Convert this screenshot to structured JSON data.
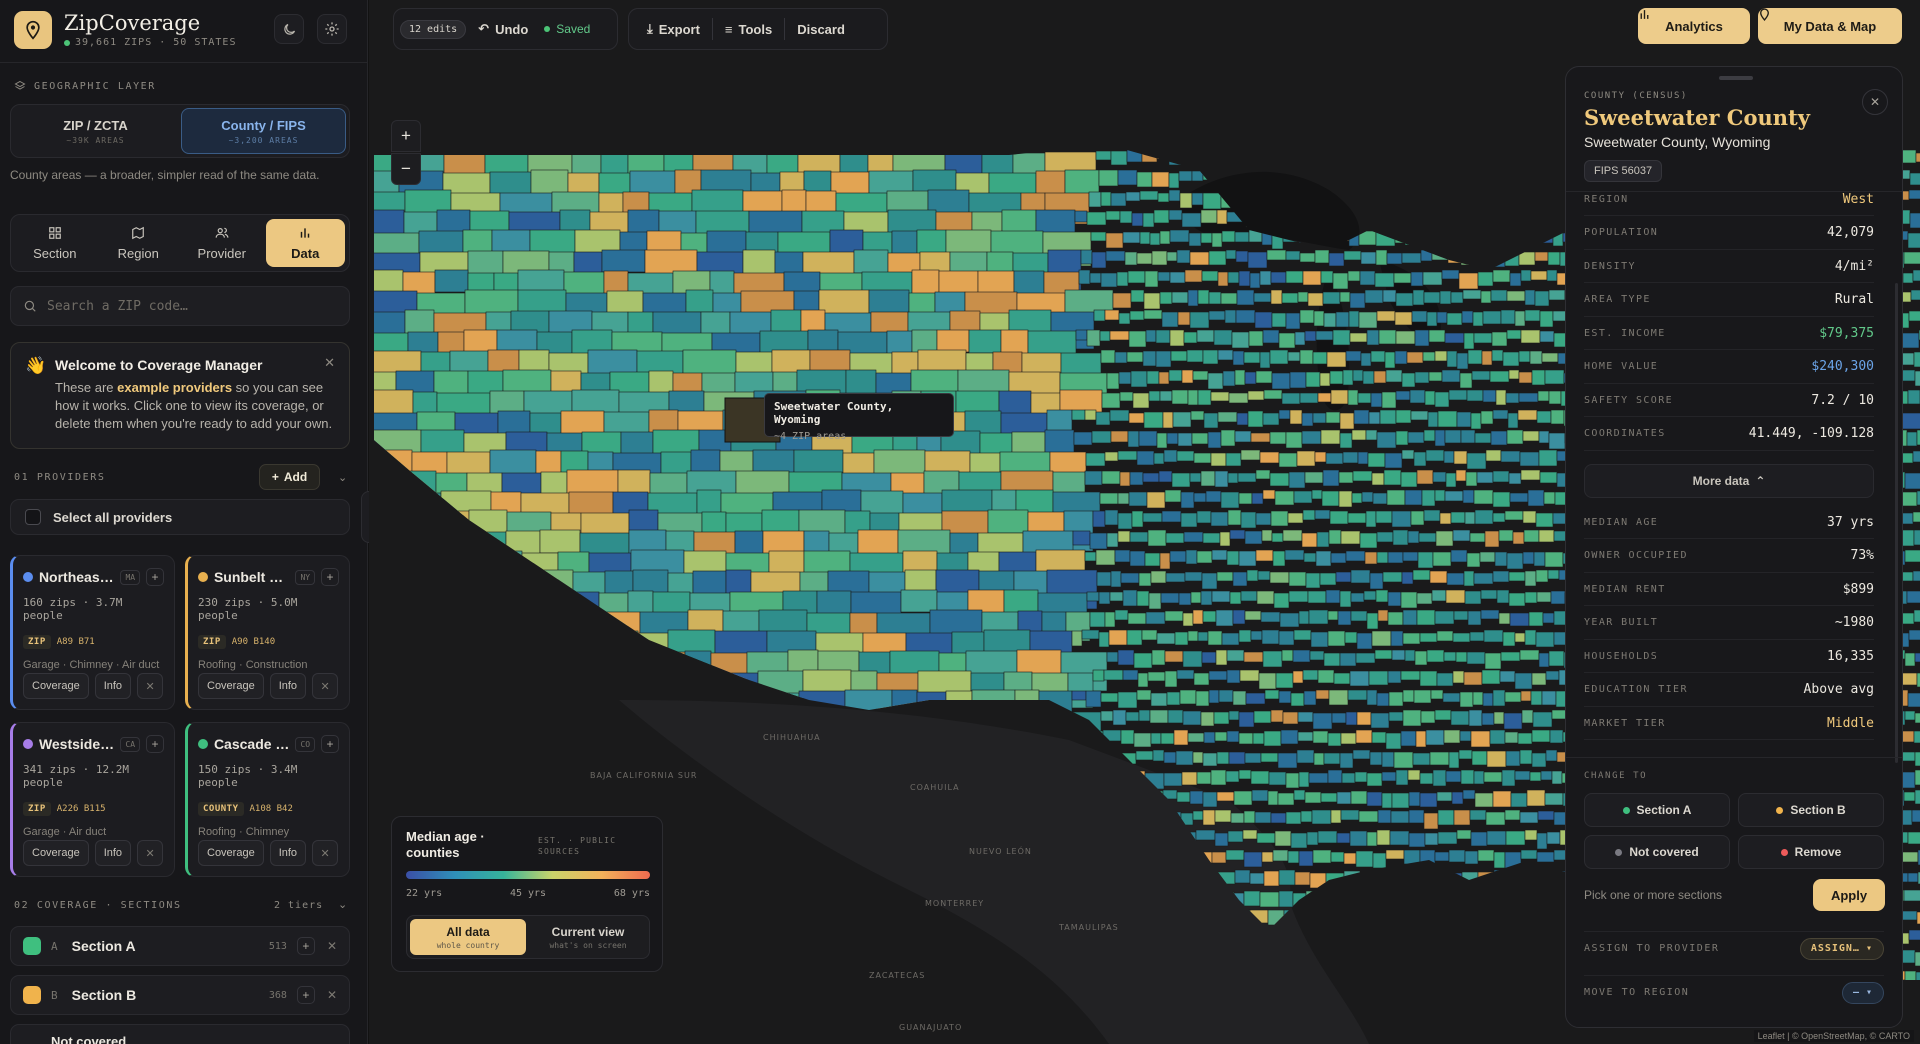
{
  "app": {
    "title": "ZipCoverage",
    "subtitle": "39,661 ZIPS · 50 STATES"
  },
  "sidebar": {
    "geo_label": "GEOGRAPHIC LAYER",
    "geo_options": [
      {
        "title": "ZIP / ZCTA",
        "sub": "~39K AREAS",
        "active": false
      },
      {
        "title": "County / FIPS",
        "sub": "~3,200 AREAS",
        "active": true
      }
    ],
    "geo_hint": "County areas — a broader, simpler read of the same data.",
    "tabs": [
      {
        "label": "Section",
        "icon": "grid-icon",
        "active": false
      },
      {
        "label": "Region",
        "icon": "map-icon",
        "active": false
      },
      {
        "label": "Provider",
        "icon": "users-icon",
        "active": false
      },
      {
        "label": "Data",
        "icon": "bar-chart-icon",
        "active": true
      }
    ],
    "search_placeholder": "Search a ZIP code…",
    "welcome": {
      "title": "Welcome to Coverage Manager",
      "text_before": "These are ",
      "highlight": "example providers",
      "text_after": " so you can see how it works. Click one to view its coverage, or delete them when you're ready to add your own."
    },
    "providers_label": "01 PROVIDERS",
    "add_label": "Add",
    "select_all": "Select all providers",
    "providers": [
      {
        "name": "Northeast Garage Pros",
        "state": "MA",
        "color": "#5b8def",
        "stats": "160 zips · 3.7M people",
        "tag": "ZIP",
        "range": "A89 B71",
        "services": "Garage · Chimney · Air duct"
      },
      {
        "name": "Sunbelt Trades",
        "state": "NY",
        "color": "#e8b04f",
        "stats": "230 zips · 5.0M people",
        "tag": "ZIP",
        "range": "A90 B140",
        "services": "Roofing · Construction"
      },
      {
        "name": "Westside Services",
        "state": "CA",
        "color": "#a77de8",
        "stats": "341 zips · 12.2M people",
        "tag": "ZIP",
        "range": "A226 B115",
        "services": "Garage · Air duct"
      },
      {
        "name": "Cascade Roofing",
        "state": "CO",
        "color": "#3fbf7f",
        "stats": "150 zips · 3.4M people",
        "tag": "COUNTY",
        "range": "A108 B42",
        "services": "Roofing · Chimney"
      }
    ],
    "card_actions": {
      "coverage": "Coverage",
      "info": "Info"
    },
    "sections_label": "02 COVERAGE · SECTIONS",
    "sections_count": "2 tiers",
    "sections": [
      {
        "letter": "A",
        "name": "Section A",
        "count": "513",
        "color": "#3fbf7f"
      },
      {
        "letter": "B",
        "name": "Section B",
        "count": "368",
        "color": "#f0b34c"
      }
    ],
    "partial_row": "Not covered"
  },
  "toolbar": {
    "edits": "12 edits",
    "undo": "Undo",
    "saved": "Saved",
    "export": "Export",
    "tools": "Tools",
    "discard": "Discard"
  },
  "top_buttons": {
    "analytics": "Analytics",
    "my_data": "My Data & Map"
  },
  "tooltip": {
    "name": "Sweetwater County, Wyoming",
    "detail": "~4 ZIP areas"
  },
  "legend": {
    "title": "Median age · counties",
    "source": "EST. · PUBLIC SOURCES",
    "min": "22 yrs",
    "mid": "45 yrs",
    "max": "68 yrs",
    "modes": [
      {
        "title": "All data",
        "sub": "whole country",
        "active": true
      },
      {
        "title": "Current view",
        "sub": "what's on screen",
        "active": false
      }
    ]
  },
  "map_labels": [
    "BAJA CALIFORNIA SUR",
    "CHIHUAHUA",
    "COAHUILA",
    "NUEVO LEÓN",
    "MONTERREY",
    "TAMAULIPAS",
    "ZACATECAS",
    "GUANAJUATO"
  ],
  "attribution": "Leaflet | © OpenStreetMap, © CARTO",
  "panel": {
    "kicker": "COUNTY (CENSUS)",
    "title": "Sweetwater County",
    "subtitle": "Sweetwater County, Wyoming",
    "fips": "FIPS 56037",
    "rows": [
      {
        "k": "REGION",
        "v": "West",
        "color": "#f0c97c"
      },
      {
        "k": "POPULATION",
        "v": "42,079",
        "color": "#ece8e0"
      },
      {
        "k": "DENSITY",
        "v": "4/mi²",
        "color": "#ece8e0"
      },
      {
        "k": "AREA TYPE",
        "v": "Rural",
        "color": "#ece8e0"
      },
      {
        "k": "EST. INCOME",
        "v": "$79,375",
        "color": "#62c98a"
      },
      {
        "k": "HOME VALUE",
        "v": "$240,300",
        "color": "#6ba4e8"
      },
      {
        "k": "SAFETY SCORE",
        "v": "7.2 / 10",
        "color": "#ece8e0"
      },
      {
        "k": "COORDINATES",
        "v": "41.449, -109.128",
        "color": "#ece8e0"
      }
    ],
    "more_data": "More data",
    "more_rows": [
      {
        "k": "MEDIAN AGE",
        "v": "37 yrs",
        "color": "#ece8e0"
      },
      {
        "k": "OWNER OCCUPIED",
        "v": "73%",
        "color": "#ece8e0"
      },
      {
        "k": "MEDIAN RENT",
        "v": "$899",
        "color": "#ece8e0"
      },
      {
        "k": "YEAR BUILT",
        "v": "~1980",
        "color": "#ece8e0"
      },
      {
        "k": "HOUSEHOLDS",
        "v": "16,335",
        "color": "#ece8e0"
      },
      {
        "k": "EDUCATION TIER",
        "v": "Above avg",
        "color": "#ece8e0"
      },
      {
        "k": "MARKET TIER",
        "v": "Middle",
        "color": "#f0c97c"
      }
    ],
    "change_label": "CHANGE TO",
    "change_options": [
      {
        "label": "Section A",
        "color": "#3fbf7f"
      },
      {
        "label": "Section B",
        "color": "#f0b34c"
      },
      {
        "label": "Not covered",
        "color": "#7a7a82"
      },
      {
        "label": "Remove",
        "color": "#ee5b5b"
      }
    ],
    "pick_hint": "Pick one or more sections",
    "apply": "Apply",
    "assign_label": "ASSIGN TO PROVIDER",
    "assign_value": "ASSIGN…",
    "move_label": "MOVE TO REGION",
    "move_value": "—"
  }
}
